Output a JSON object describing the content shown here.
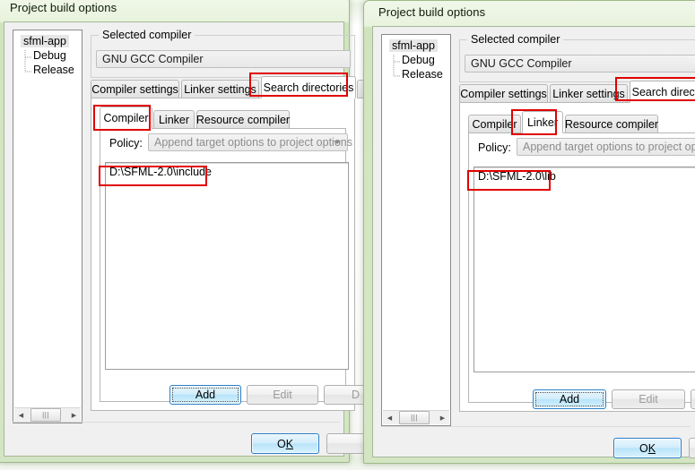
{
  "windows": [
    {
      "id": "left",
      "title": "Project build options",
      "tree": {
        "root": "sfml-app",
        "children": [
          "Debug",
          "Release"
        ]
      },
      "compiler_group": {
        "label": "Selected compiler",
        "selected": "GNU GCC Compiler"
      },
      "main_tabs": [
        {
          "label": "Compiler settings",
          "active": false
        },
        {
          "label": "Linker settings",
          "active": false
        },
        {
          "label": "Search directories",
          "active": true
        }
      ],
      "sub_tabs": [
        {
          "label": "Compiler",
          "active": true
        },
        {
          "label": "Linker",
          "active": false
        },
        {
          "label": "Resource compiler",
          "active": false
        }
      ],
      "policy": {
        "label": "Policy:",
        "value": "Append target options to project options"
      },
      "directories": [
        "D:\\SFML-2.0\\include"
      ],
      "list_buttons": [
        {
          "label": "Add",
          "state": "default-focused"
        },
        {
          "label": "Edit",
          "state": "disabled"
        },
        {
          "label": "D",
          "state": "disabled"
        }
      ],
      "dialog_buttons": [
        {
          "label_html": "O<u>K</u>",
          "label": "OK",
          "state": "default"
        },
        {
          "label": "",
          "state": "normal"
        }
      ]
    },
    {
      "id": "right",
      "title": "Project build options",
      "tree": {
        "root": "sfml-app",
        "children": [
          "Debug",
          "Release"
        ]
      },
      "compiler_group": {
        "label": "Selected compiler",
        "selected": "GNU GCC Compiler"
      },
      "main_tabs": [
        {
          "label": "Compiler settings",
          "active": false
        },
        {
          "label": "Linker settings",
          "active": false
        },
        {
          "label": "Search directories",
          "active": true
        }
      ],
      "sub_tabs": [
        {
          "label": "Compiler",
          "active": false
        },
        {
          "label": "Linker",
          "active": true
        },
        {
          "label": "Resource compiler",
          "active": false
        }
      ],
      "policy": {
        "label": "Policy:",
        "value": "Append target options to project options"
      },
      "directories": [
        "D:\\SFML-2.0\\lib"
      ],
      "list_buttons": [
        {
          "label": "Add",
          "state": "default-focused"
        },
        {
          "label": "Edit",
          "state": "disabled"
        },
        {
          "label": "",
          "state": "disabled"
        }
      ],
      "dialog_buttons": [
        {
          "label_html": "O<u>K</u>",
          "label": "OK",
          "state": "default"
        },
        {
          "label": "",
          "state": "normal"
        }
      ]
    }
  ],
  "scrollbar": {
    "left_arrow_glyph": "◀",
    "right_arrow_glyph": "▶",
    "grip_glyph": "|||"
  },
  "colors": {
    "annotation_red": "#e00000",
    "title_green": "#d9ebc6",
    "default_button_blue": "#2a7fc9"
  }
}
